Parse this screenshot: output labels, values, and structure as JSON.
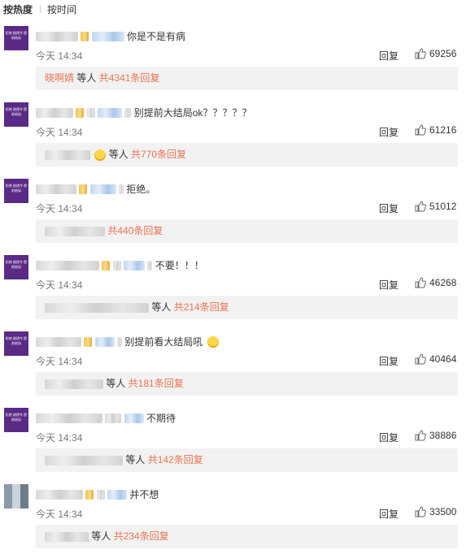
{
  "sort": {
    "hot": "按热度",
    "time": "按时间"
  },
  "avatar_text": "拒绝 剧透令 提前结局",
  "comments": [
    {
      "text": "你是不是有病",
      "time": "今天 14:34",
      "reply": "回复",
      "likes": "69256",
      "thread_name": "晓啊婧",
      "thread_mid": "等人",
      "thread_count": "共4341条回复"
    },
    {
      "text": "别提前大结局ok？？？？？",
      "time": "今天 14:34",
      "reply": "回复",
      "likes": "61216",
      "thread_mid": "等人",
      "thread_count": "共770条回复"
    },
    {
      "text": "拒绝。",
      "time": "今天 14:34",
      "reply": "回复",
      "likes": "51012",
      "thread_count": "共440条回复"
    },
    {
      "text": "不要！！！",
      "time": "今天 14:34",
      "reply": "回复",
      "likes": "46268",
      "thread_mid": "等人",
      "thread_count": "共214条回复"
    },
    {
      "text": "别提前看大结局吼",
      "time": "今天 14:34",
      "reply": "回复",
      "likes": "40464",
      "thread_mid": "等人",
      "thread_count": "共181条回复"
    },
    {
      "text": "不期待",
      "time": "今天 14:34",
      "reply": "回复",
      "likes": "38886",
      "thread_mid": "等人",
      "thread_count": "共142条回复"
    },
    {
      "text": "并不想",
      "time": "今天 14:34",
      "reply": "回复",
      "likes": "33500",
      "thread_mid": "等人",
      "thread_count": "共234条回复"
    }
  ]
}
